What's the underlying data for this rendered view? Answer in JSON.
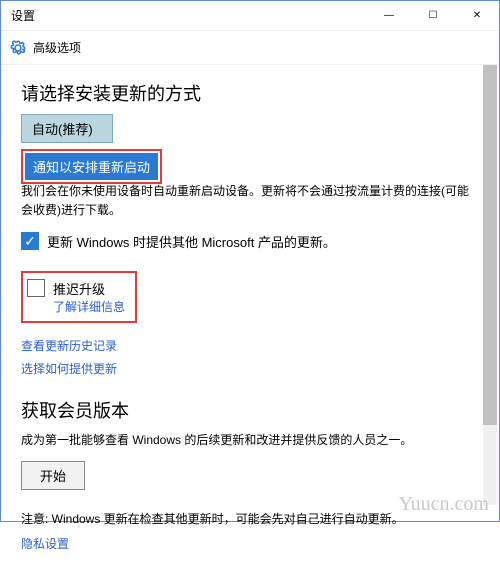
{
  "window": {
    "title": "设置",
    "min": "—",
    "max": "☐",
    "close": "✕"
  },
  "header": {
    "label": "高级选项"
  },
  "section1": {
    "heading": "请选择安装更新的方式",
    "dropdown_selected": "自动(推荐)",
    "dropdown_option2": "通知以安排重新启动",
    "desc": "我们会在你未使用设备时自动重新启动设备。更新将不会通过按流量计费的连接(可能会收费)进行下载。",
    "chk_ms_label": "更新 Windows 时提供其他 Microsoft 产品的更新。",
    "chk_defer_label": "推迟升级",
    "learn_more": "了解详细信息",
    "link_history": "查看更新历史记录",
    "link_how": "选择如何提供更新"
  },
  "section2": {
    "heading": "获取会员版本",
    "desc": "成为第一批能够查看 Windows 的后续更新和改进并提供反馈的人员之一。",
    "btn_start": "开始",
    "note": "注意: Windows 更新在检查其他更新时，可能会先对自己进行自动更新。",
    "link_privacy": "隐私设置"
  },
  "watermark": "Yuucn.com"
}
